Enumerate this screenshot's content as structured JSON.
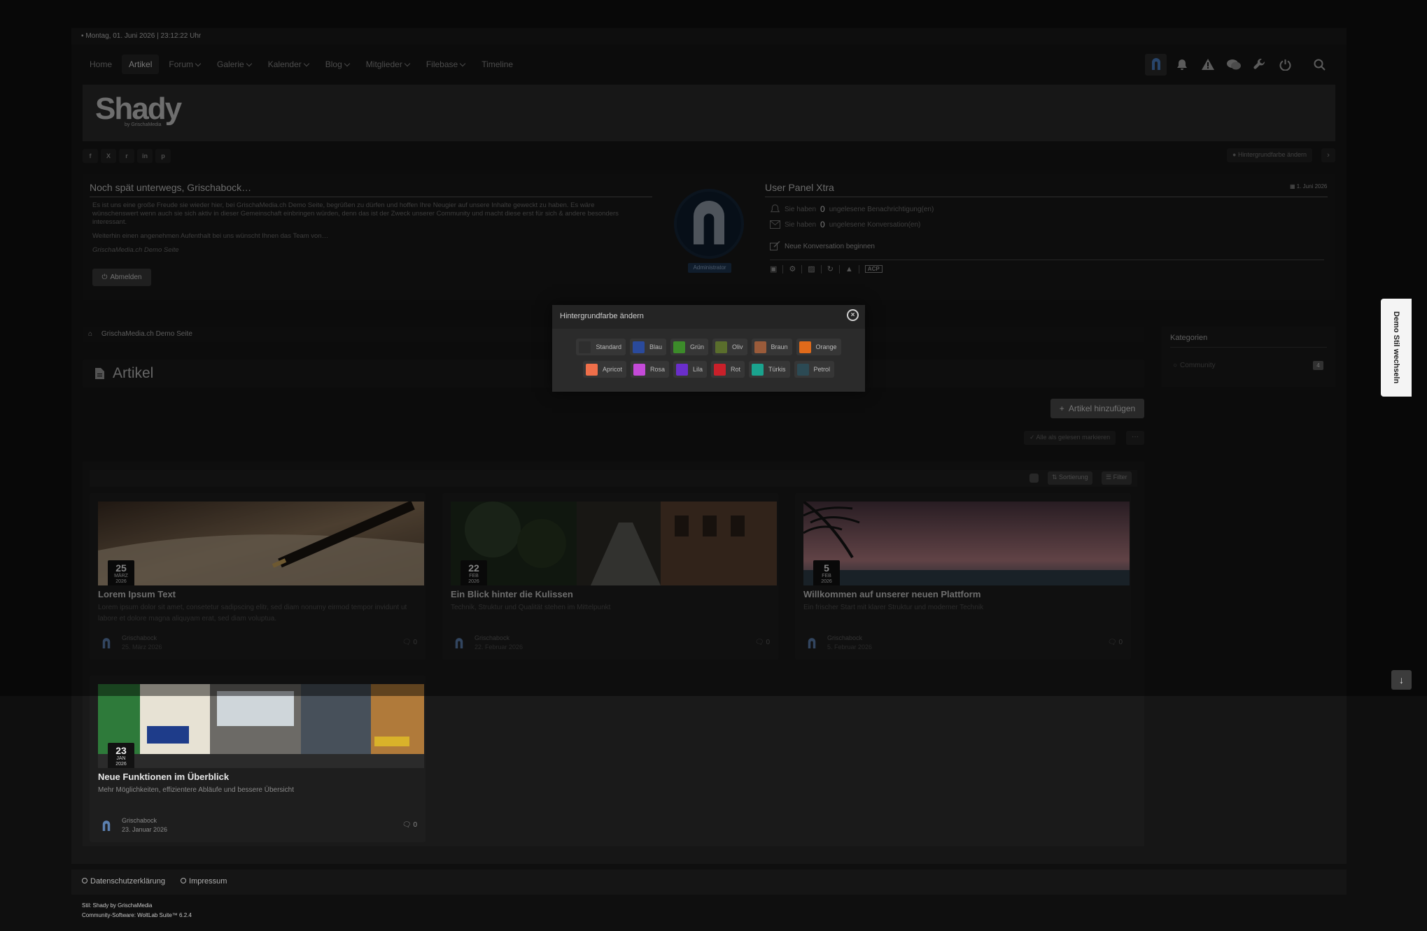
{
  "topbar": {
    "datetime": "Montag, 01. Juni 2026 | 23:12:22 Uhr"
  },
  "nav": {
    "items": [
      {
        "label": "Home"
      },
      {
        "label": "Artikel"
      },
      {
        "label": "Forum"
      },
      {
        "label": "Galerie"
      },
      {
        "label": "Kalender"
      },
      {
        "label": "Blog"
      },
      {
        "label": "Mitglieder"
      },
      {
        "label": "Filebase"
      },
      {
        "label": "Timeline"
      }
    ],
    "icons": [
      "user-menu-icon",
      "bell-icon",
      "warning-icon",
      "conversations-icon",
      "wrench-icon",
      "power-icon",
      "search-icon"
    ]
  },
  "logo": {
    "text": "Shady",
    "sub": "by GrischaMedia"
  },
  "social": {
    "icons": [
      "facebook-icon",
      "x-icon",
      "reddit-icon",
      "linkedin-icon",
      "pinterest-icon"
    ],
    "labels": [
      "f",
      "X",
      "r",
      "in",
      "p"
    ]
  },
  "bgchange": {
    "label": "Hintergrundfarbe ändern"
  },
  "welcome": {
    "title": "Noch spät unterwegs, Grischabock…",
    "text1": "Es ist uns eine große Freude sie wieder hier, bei GrischaMedia.ch Demo Seite, begrüßen zu dürfen und hoffen Ihre Neugier auf unsere Inhalte geweckt zu haben. Es wäre wünschenswert wenn auch sie sich aktiv in dieser Gemeinschaft einbringen würden, denn das ist der Zweck unserer Community und macht diese erst für sich & andere besonders interessant.",
    "text2": "Weiterhin einen angenehmen Aufenthalt bei uns wünscht Ihnen das Team von…",
    "signature": "GrischaMedia.ch Demo Seite",
    "logout": "Abmelden"
  },
  "user": {
    "role": "Administrator"
  },
  "panel": {
    "title": "User Panel Xtra",
    "date": "1. Juni 2026",
    "notif_pre": "Sie haben",
    "notif_count": "0",
    "notif_post": "ungelesene Benachrichtigung(en)",
    "conv_pre": "Sie haben",
    "conv_count": "0",
    "conv_post": "ungelesene Konversation(en)",
    "new_conv": "Neue Konversation beginnen",
    "acp": "ACP"
  },
  "breadcrumb": {
    "home": "GrischaMedia.ch Demo Seite"
  },
  "page": {
    "title": "Artikel",
    "add_button": "Artikel hinzufügen",
    "mark_read": "Alle als gelesen markieren",
    "more": "···",
    "sort": "Sortierung",
    "filter": "Filter"
  },
  "articles": [
    {
      "title": "Lorem Ipsum Text",
      "desc": "Lorem ipsum dolor sit amet, consetetur sadipscing elitr, sed diam nonumy eirmod tempor invidunt ut labore et dolore magna aliquyam erat, sed diam voluptua.",
      "day": "25",
      "month": "MÄRZ",
      "year": "2026",
      "author": "Grischabock",
      "date": "25. März 2026",
      "comments": "0"
    },
    {
      "title": "Ein Blick hinter die Kulissen",
      "desc": "Technik, Struktur und Qualität stehen im Mittelpunkt",
      "day": "22",
      "month": "FEB",
      "year": "2026",
      "author": "Grischabock",
      "date": "22. Februar 2026",
      "comments": "0"
    },
    {
      "title": "Willkommen auf unserer neuen Plattform",
      "desc": "Ein frischer Start mit klarer Struktur und moderner Technik",
      "day": "5",
      "month": "FEB",
      "year": "2026",
      "author": "Grischabock",
      "date": "5. Februar 2026",
      "comments": "0"
    },
    {
      "title": "Neue Funktionen im Überblick",
      "desc": "Mehr Möglichkeiten, effizientere Abläufe und bessere Übersicht",
      "day": "23",
      "month": "JAN",
      "year": "2026",
      "author": "Grischabock",
      "date": "23. Januar 2026",
      "comments": "0"
    }
  ],
  "sidebar": {
    "title": "Kategorien",
    "item": "Community",
    "count": "4"
  },
  "footer": {
    "privacy": "Datenschutzerklärung",
    "imprint": "Impressum"
  },
  "copyright": {
    "line1": "Stil: Shady by GrischaMedia",
    "line2": "Community-Software: WoltLab Suite™ 6.2.4"
  },
  "dialog": {
    "title": "Hintergrundfarbe ändern",
    "colors": [
      {
        "label": "Standard",
        "color": "#2e2e2e"
      },
      {
        "label": "Blau",
        "color": "#2a4a9c"
      },
      {
        "label": "Grün",
        "color": "#3c8b2a"
      },
      {
        "label": "Oliv",
        "color": "#5a6e2c"
      },
      {
        "label": "Braun",
        "color": "#9a5b3a"
      },
      {
        "label": "Orange",
        "color": "#e06a1a"
      },
      {
        "label": "Apricot",
        "color": "#ef6f4a"
      },
      {
        "label": "Rosa",
        "color": "#c44ad8"
      },
      {
        "label": "Lila",
        "color": "#6a2ecb"
      },
      {
        "label": "Rot",
        "color": "#c9202a"
      },
      {
        "label": "Türkis",
        "color": "#1aa38e"
      },
      {
        "label": "Petrol",
        "color": "#2c4a54"
      }
    ]
  },
  "demo_tab": {
    "label": "Demo Stil wechseln"
  }
}
